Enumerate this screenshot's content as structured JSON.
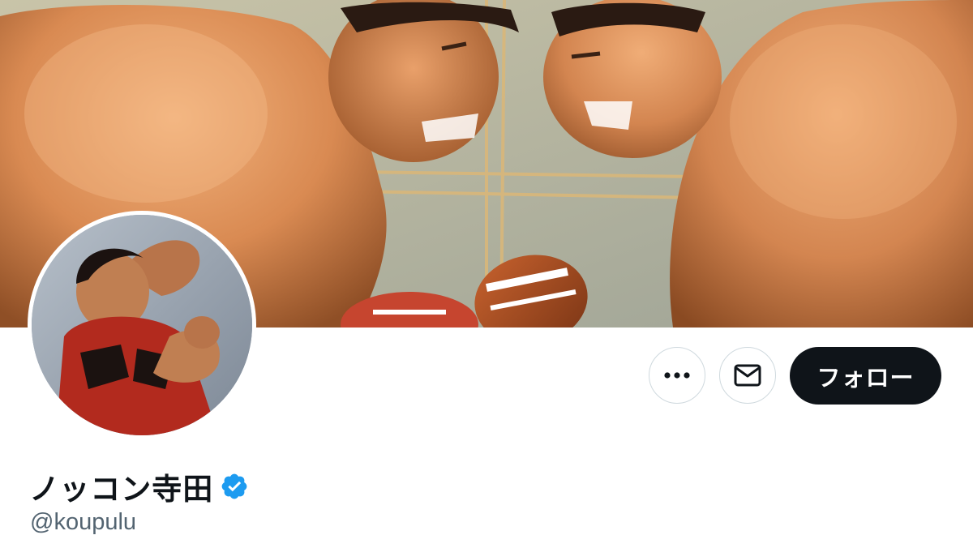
{
  "profile": {
    "display_name": "ノッコン寺田",
    "handle": "@koupulu",
    "verified": true
  },
  "actions": {
    "more_icon": "more-horizontal-icon",
    "message_icon": "mail-icon",
    "follow_label": "フォロー"
  },
  "colors": {
    "follow_bg": "#0f1419",
    "verified_blue": "#1d9bf0",
    "handle_gray": "#536471",
    "button_border": "#cfd9de"
  }
}
